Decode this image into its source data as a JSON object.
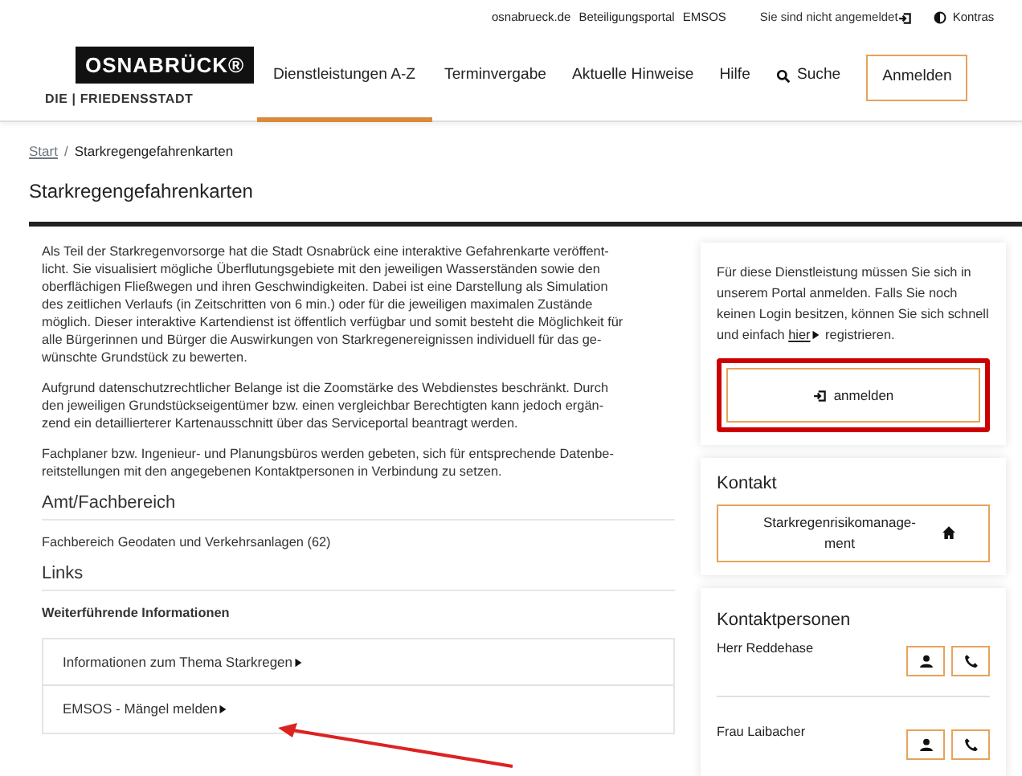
{
  "top_links": [
    {
      "label": "osnabrueck.de"
    },
    {
      "label": "Beteiligungsportal"
    },
    {
      "label": "EMSOS"
    }
  ],
  "login_status": "Sie sind nicht angemeldet",
  "contrast": "Kontras",
  "logo": {
    "name": "OSNABRÜCK®",
    "subtitle": "DIE | FRIEDENSSTADT"
  },
  "nav": [
    {
      "label": "Dienstleistungen A-Z",
      "selected": true
    },
    {
      "label": "Terminvergabe",
      "selected": false
    },
    {
      "label": "Aktuelle Hinweise",
      "selected": false
    },
    {
      "label": "Hilfe",
      "selected": false
    }
  ],
  "search": "Suche",
  "login_button": "Anmelden",
  "breadcrumb_separator": "/",
  "breadcrumb": [
    {
      "label": "Start",
      "link": true
    },
    {
      "label": "Starkregengefahrenkarten",
      "link": false
    }
  ],
  "title": "Starkregengefahrenkarten",
  "paragraphs": [
    [
      "Als Teil der Starkregenvorsorge hat die Stadt Osnabrück eine interaktive Gefahrenkarte veröffent-",
      "licht. Sie visualisiert mögliche Überflutungsgebiete mit den jeweiligen Wasserständen sowie den",
      "oberflächigen Fließwegen und ihren Geschwindigkeiten. Dabei ist eine Darstellung als Simulation",
      "des zeitlichen Verlaufs (in Zeitschritten von 6 min.) oder für die jeweiligen maximalen Zustände",
      "möglich. Dieser interaktive Kartendienst ist öffentlich verfügbar und somit besteht die Möglichkeit für",
      "alle Bürgerinnen und Bürger die Auswirkungen von Starkregenereignissen  individuell für das ge-",
      "wünschte Grundstück zu bewerten."
    ],
    [
      "Aufgrund datenschutzrechtlicher Belange ist die Zoomstärke des Webdienstes beschränkt. Durch",
      "den jeweiligen Grundstückseigentümer bzw. einen vergleichbar Berechtigten kann jedoch ergän-",
      "zend ein detaillierterer Kartenausschnitt über das Serviceportal beantragt werden."
    ],
    [
      "Fachplaner bzw. Ingenieur- und Planungsbüros werden gebeten, sich für entsprechende Datenbe-",
      "reitstellungen mit den angegebenen Kontaktpersonen in Verbindung zu setzen."
    ]
  ],
  "department": {
    "heading": "Amt/Fachbereich",
    "value": "Fachbereich Geodaten und Verkehrsanlagen (62)"
  },
  "links": {
    "heading": "Links",
    "subheading": "Weiterführende Informationen",
    "items": [
      {
        "label": "Informationen zum Thema Starkregen",
        "arrow": false
      },
      {
        "label": "EMSOS - Mängel melden",
        "arrow": true
      }
    ]
  },
  "sidebar": {
    "login_card": {
      "text_before": "Für diese Dienstleistung müssen Sie sich in unserem Portal anmelden. Falls Sie noch keinen Login besitzen, können Sie sich schnell und einfach",
      "link": "hier",
      "text_after": "registrieren.",
      "button": "anmelden",
      "highlighted": true
    },
    "contact": {
      "heading": "Kontakt",
      "button": "Starkregenrisikomanage-ment"
    },
    "persons": {
      "heading": "Kontaktpersonen",
      "items": [
        {
          "name": "Herr Reddehase"
        },
        {
          "name": "Frau Laibacher"
        }
      ]
    }
  }
}
